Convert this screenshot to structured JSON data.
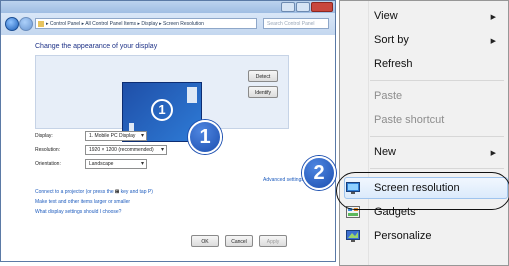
{
  "window": {
    "address": "▸ Control Panel ▸ All Control Panel Items ▸ Display ▸ Screen Resolution",
    "search_placeholder": "Search Control Panel",
    "heading": "Change the appearance of your display",
    "monitor_number": "1",
    "detect_label": "Detect",
    "identify_label": "Identify",
    "display_label": "Display:",
    "display_value": "1. Mobile PC Display",
    "resolution_label": "Resolution:",
    "resolution_value": "1920 × 1200 (recommended)",
    "orientation_label": "Orientation:",
    "orientation_value": "Landscape",
    "advanced_link": "Advanced settings",
    "link_projector": "Connect to a projector (or press the",
    "link_projector_end": "key and tap P)",
    "link_text_size": "Make text and other items larger or smaller",
    "link_settings": "What display settings should I choose?",
    "ok_label": "OK",
    "cancel_label": "Cancel",
    "apply_label": "Apply"
  },
  "badges": {
    "one": "1",
    "two": "2"
  },
  "context_menu": {
    "items": [
      {
        "label": "View",
        "disabled": false,
        "submenu": true
      },
      {
        "label": "Sort by",
        "disabled": false,
        "submenu": true
      },
      {
        "label": "Refresh",
        "disabled": false,
        "submenu": false
      },
      {
        "label": "Paste",
        "disabled": true,
        "submenu": false
      },
      {
        "label": "Paste shortcut",
        "disabled": true,
        "submenu": false
      },
      {
        "label": "New",
        "disabled": false,
        "submenu": true
      },
      {
        "label": "Screen resolution",
        "disabled": false,
        "submenu": false,
        "highlighted": true,
        "icon": "screen-resolution-icon"
      },
      {
        "label": "Gadgets",
        "disabled": false,
        "submenu": false,
        "icon": "gadgets-icon"
      },
      {
        "label": "Personalize",
        "disabled": false,
        "submenu": false,
        "icon": "personalize-icon"
      }
    ]
  },
  "colors": {
    "badge": "#1c4fb0",
    "link": "#1e5cbe",
    "menu_bg": "#f1f1f1",
    "highlight": "#dbeafb"
  }
}
